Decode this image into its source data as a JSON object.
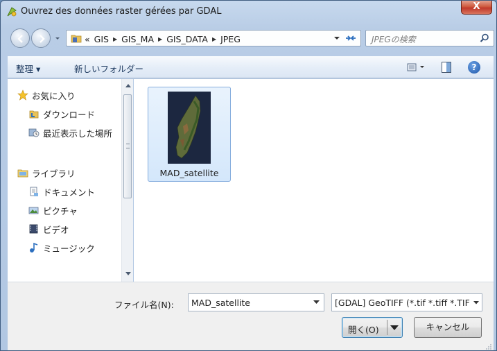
{
  "window": {
    "title": "Ouvrez des données raster gérées par GDAL",
    "close_label": "X"
  },
  "navigation": {
    "breadcrumb_prefix": "«",
    "breadcrumb": [
      "GIS",
      "GIS_MA",
      "GIS_DATA",
      "JPEG"
    ],
    "search_placeholder": "JPEGの検索"
  },
  "toolbar": {
    "organize_label": "整理 ▾",
    "new_folder_label": "新しいフォルダー",
    "help_label": "?"
  },
  "nav_pane": {
    "favorites": "お気に入り",
    "downloads": "ダウンロード",
    "recent": "最近表示した場所",
    "libraries": "ライブラリ",
    "documents": "ドキュメント",
    "pictures": "ピクチャ",
    "videos": "ビデオ",
    "music": "ミュージック"
  },
  "files": [
    {
      "name": "MAD_satellite",
      "selected": true
    }
  ],
  "bottom": {
    "filename_label": "ファイル名(N):",
    "filename_value": "MAD_satellite",
    "filetype_value": "[GDAL] GeoTIFF (*.tif *.tiff *.TIF *.TIFF)",
    "open_label": "開く(O)",
    "cancel_label": "キャンセル"
  },
  "colors": {
    "window_frame": "#b9cde6",
    "selection": "#d4e7fb",
    "close_button": "#c0392b"
  }
}
